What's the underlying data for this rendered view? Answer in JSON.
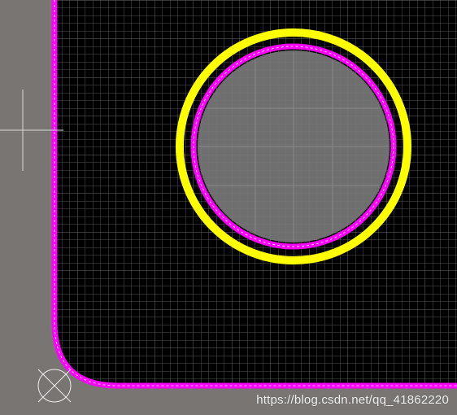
{
  "colors": {
    "background": "#787573",
    "board": "#000000",
    "grid_minor": "#545454",
    "grid_major": "#6b6b6b",
    "outline": "#ff00ff",
    "outline_dash": "#ffd6ff",
    "pad_ring": "#ffff00",
    "hole_fill": "#7a7878",
    "cursor": "#d9d9d9",
    "origin_marker": "#f0f0f0"
  },
  "icons": {
    "origin": "origin-marker-icon",
    "cursor": "crosshair-cursor-icon"
  },
  "watermark": "https://blog.csdn.net/qq_41862220"
}
